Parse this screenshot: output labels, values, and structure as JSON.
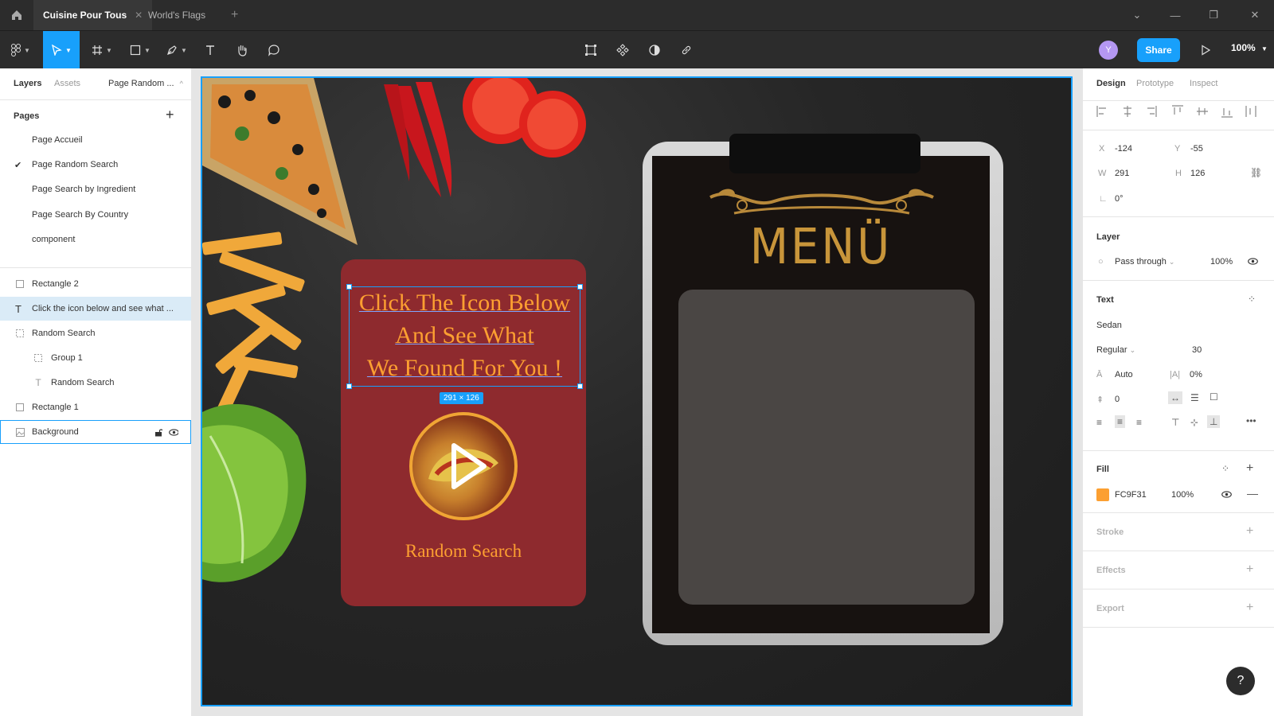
{
  "tabs": [
    {
      "label": "Cuisine Pour Tous",
      "active": true
    },
    {
      "label": "World's Flags",
      "active": false
    }
  ],
  "toolbar": {
    "avatar_initial": "Y",
    "share_label": "Share",
    "zoom": "100%"
  },
  "left_panel": {
    "tabs": [
      "Layers",
      "Assets",
      "Page Random ..."
    ],
    "pages_header": "Pages",
    "pages": [
      {
        "label": "Page Accueil",
        "current": false
      },
      {
        "label": "Page Random Search",
        "current": true
      },
      {
        "label": "Page Search by Ingredient",
        "current": false
      },
      {
        "label": "Page  Search By Country",
        "current": false
      },
      {
        "label": "component",
        "current": false
      }
    ],
    "layers": [
      {
        "label": "Rectangle 2",
        "icon": "rectangle-icon"
      },
      {
        "label": "Click the icon below and see what ...",
        "icon": "text-icon",
        "selected": true
      },
      {
        "label": "Random Search",
        "icon": "frame-icon"
      },
      {
        "label": "Group 1",
        "icon": "group-icon"
      },
      {
        "label": "Random Search",
        "icon": "text-icon"
      },
      {
        "label": "Rectangle 1",
        "icon": "rectangle-icon"
      },
      {
        "label": "Background",
        "icon": "image-icon",
        "hovered": true
      }
    ]
  },
  "canvas": {
    "card": {
      "title_lines": [
        "Click The Icon Below",
        "And See What",
        "We Found For You !"
      ],
      "subtitle": "Random Search"
    },
    "selection_dims": "291 × 126",
    "menu_title": "MENÜ"
  },
  "right_panel": {
    "tabs": [
      "Design",
      "Prototype",
      "Inspect"
    ],
    "x_label": "X",
    "x": "-124",
    "y_label": "Y",
    "y": "-55",
    "w_label": "W",
    "w": "291",
    "h_label": "H",
    "h": "126",
    "rotation": "0°",
    "layer_header": "Layer",
    "blend_mode": "Pass through",
    "layer_opacity": "100%",
    "text_header": "Text",
    "font_family": "Sedan",
    "font_weight": "Regular",
    "font_size": "30",
    "line_height": "Auto",
    "letter_spacing": "0%",
    "paragraph_spacing": "0",
    "fill_header": "Fill",
    "fill_hex": "FC9F31",
    "fill_color": "#fc9f31",
    "fill_opacity": "100%",
    "stroke_header": "Stroke",
    "effects_header": "Effects",
    "export_header": "Export"
  },
  "help_label": "?",
  "colors": {
    "accent": "#18a0fb",
    "card": "#8e2a2e",
    "menu_gold": "#c8953a"
  }
}
